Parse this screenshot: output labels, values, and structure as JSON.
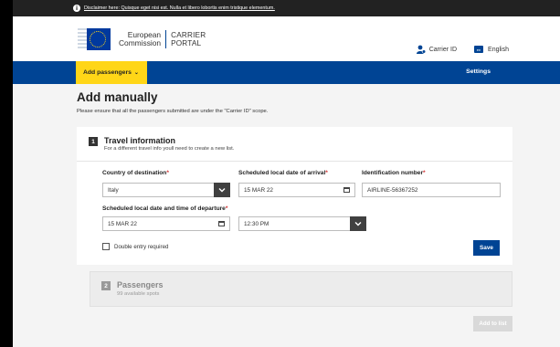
{
  "disclaimer": {
    "text": "Disclaimer here: Quisque eget nisi est. Nulla et libero lobortis enim tristique elementum."
  },
  "header": {
    "logo_line1": "European",
    "logo_line2": "Commission",
    "portal_line1": "CARRIER",
    "portal_line2": "PORTAL",
    "carrier_id": "Carrier ID",
    "language_code": "en",
    "language": "English"
  },
  "nav": {
    "add_passengers": "Add passengers",
    "settings": "Settings"
  },
  "page": {
    "title": "Add manually",
    "subtitle": "Please ensure that all the passengers submitted are under the \"Carrier ID\" scope."
  },
  "travel": {
    "step": "1",
    "title": "Travel information",
    "subtitle": "For a different travel info youll need to create a new list.",
    "country_label": "Country of destination",
    "country_value": "Italy",
    "arrival_label": "Scheduled local date of arrival",
    "arrival_value": "15 MAR 22",
    "id_label": "Identification number",
    "id_value": "AIRLINE-56367252",
    "departure_label": "Scheduled local date and time of departure",
    "departure_date": "15 MAR 22",
    "departure_time": "12:30 PM",
    "double_entry": "Double entry required",
    "save": "Save",
    "required_mark": "*"
  },
  "passengers": {
    "step": "2",
    "title": "Passengers",
    "subtitle": "99 available spots"
  },
  "add_to_list": "Add to list",
  "colors": {
    "primary": "#004494",
    "accent": "#ffd617",
    "required": "#d32f2f"
  }
}
